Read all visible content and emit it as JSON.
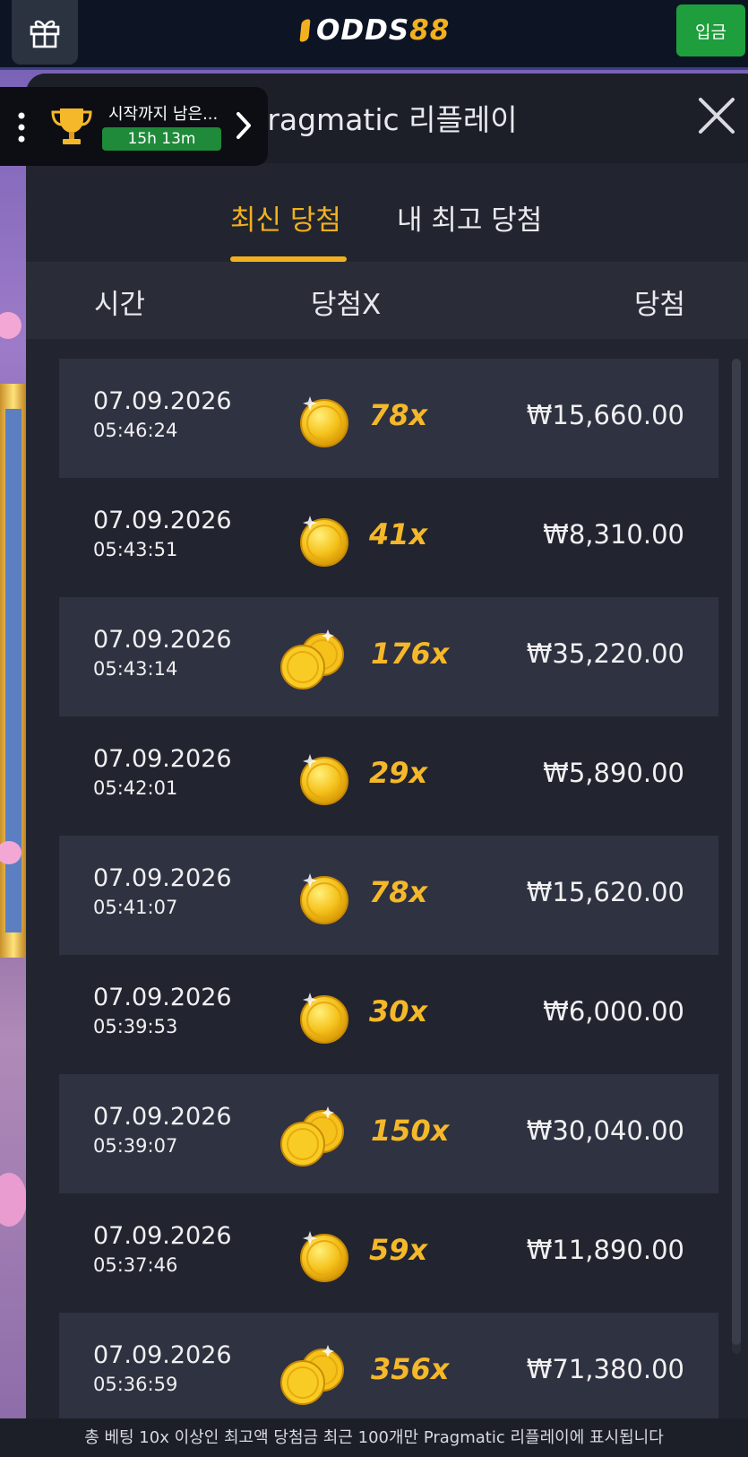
{
  "topbar": {
    "logo_main": "ODDS",
    "logo_accent": "88",
    "deposit_label": "입금"
  },
  "tournament": {
    "label": "시작까지 남은...",
    "timer": "15h 13m"
  },
  "modal": {
    "title": "Pragmatic 리플레이",
    "tabs": [
      {
        "label": "최신 당첨",
        "active": true
      },
      {
        "label": "내 최고 당첨",
        "active": false
      }
    ],
    "columns": {
      "time": "시간",
      "multiplier": "당첨X",
      "win": "당첨"
    },
    "rows": [
      {
        "date": "07.09.2026",
        "time": "05:46:24",
        "coins": "single",
        "multiplier": "78x",
        "amount": "₩15,660.00"
      },
      {
        "date": "07.09.2026",
        "time": "05:43:51",
        "coins": "single",
        "multiplier": "41x",
        "amount": "₩8,310.00"
      },
      {
        "date": "07.09.2026",
        "time": "05:43:14",
        "coins": "double",
        "multiplier": "176x",
        "amount": "₩35,220.00"
      },
      {
        "date": "07.09.2026",
        "time": "05:42:01",
        "coins": "single",
        "multiplier": "29x",
        "amount": "₩5,890.00"
      },
      {
        "date": "07.09.2026",
        "time": "05:41:07",
        "coins": "single",
        "multiplier": "78x",
        "amount": "₩15,620.00"
      },
      {
        "date": "07.09.2026",
        "time": "05:39:53",
        "coins": "single",
        "multiplier": "30x",
        "amount": "₩6,000.00"
      },
      {
        "date": "07.09.2026",
        "time": "05:39:07",
        "coins": "double",
        "multiplier": "150x",
        "amount": "₩30,040.00"
      },
      {
        "date": "07.09.2026",
        "time": "05:37:46",
        "coins": "single",
        "multiplier": "59x",
        "amount": "₩11,890.00"
      },
      {
        "date": "07.09.2026",
        "time": "05:36:59",
        "coins": "double",
        "multiplier": "356x",
        "amount": "₩71,380.00"
      }
    ],
    "footer": "총 베팅 10x 이상인 최고액 당첨금 최근 100개만 Pragmatic 리플레이에 표시됩니다"
  },
  "colors": {
    "accent": "#f2b01e",
    "deposit": "#1e9e3c",
    "row_shade": "#2f3240",
    "panel": "#22252f"
  },
  "icons": [
    "gift-icon",
    "trophy-icon",
    "menu-dots-icon",
    "chevron-right-icon",
    "close-icon",
    "coin-icon"
  ]
}
